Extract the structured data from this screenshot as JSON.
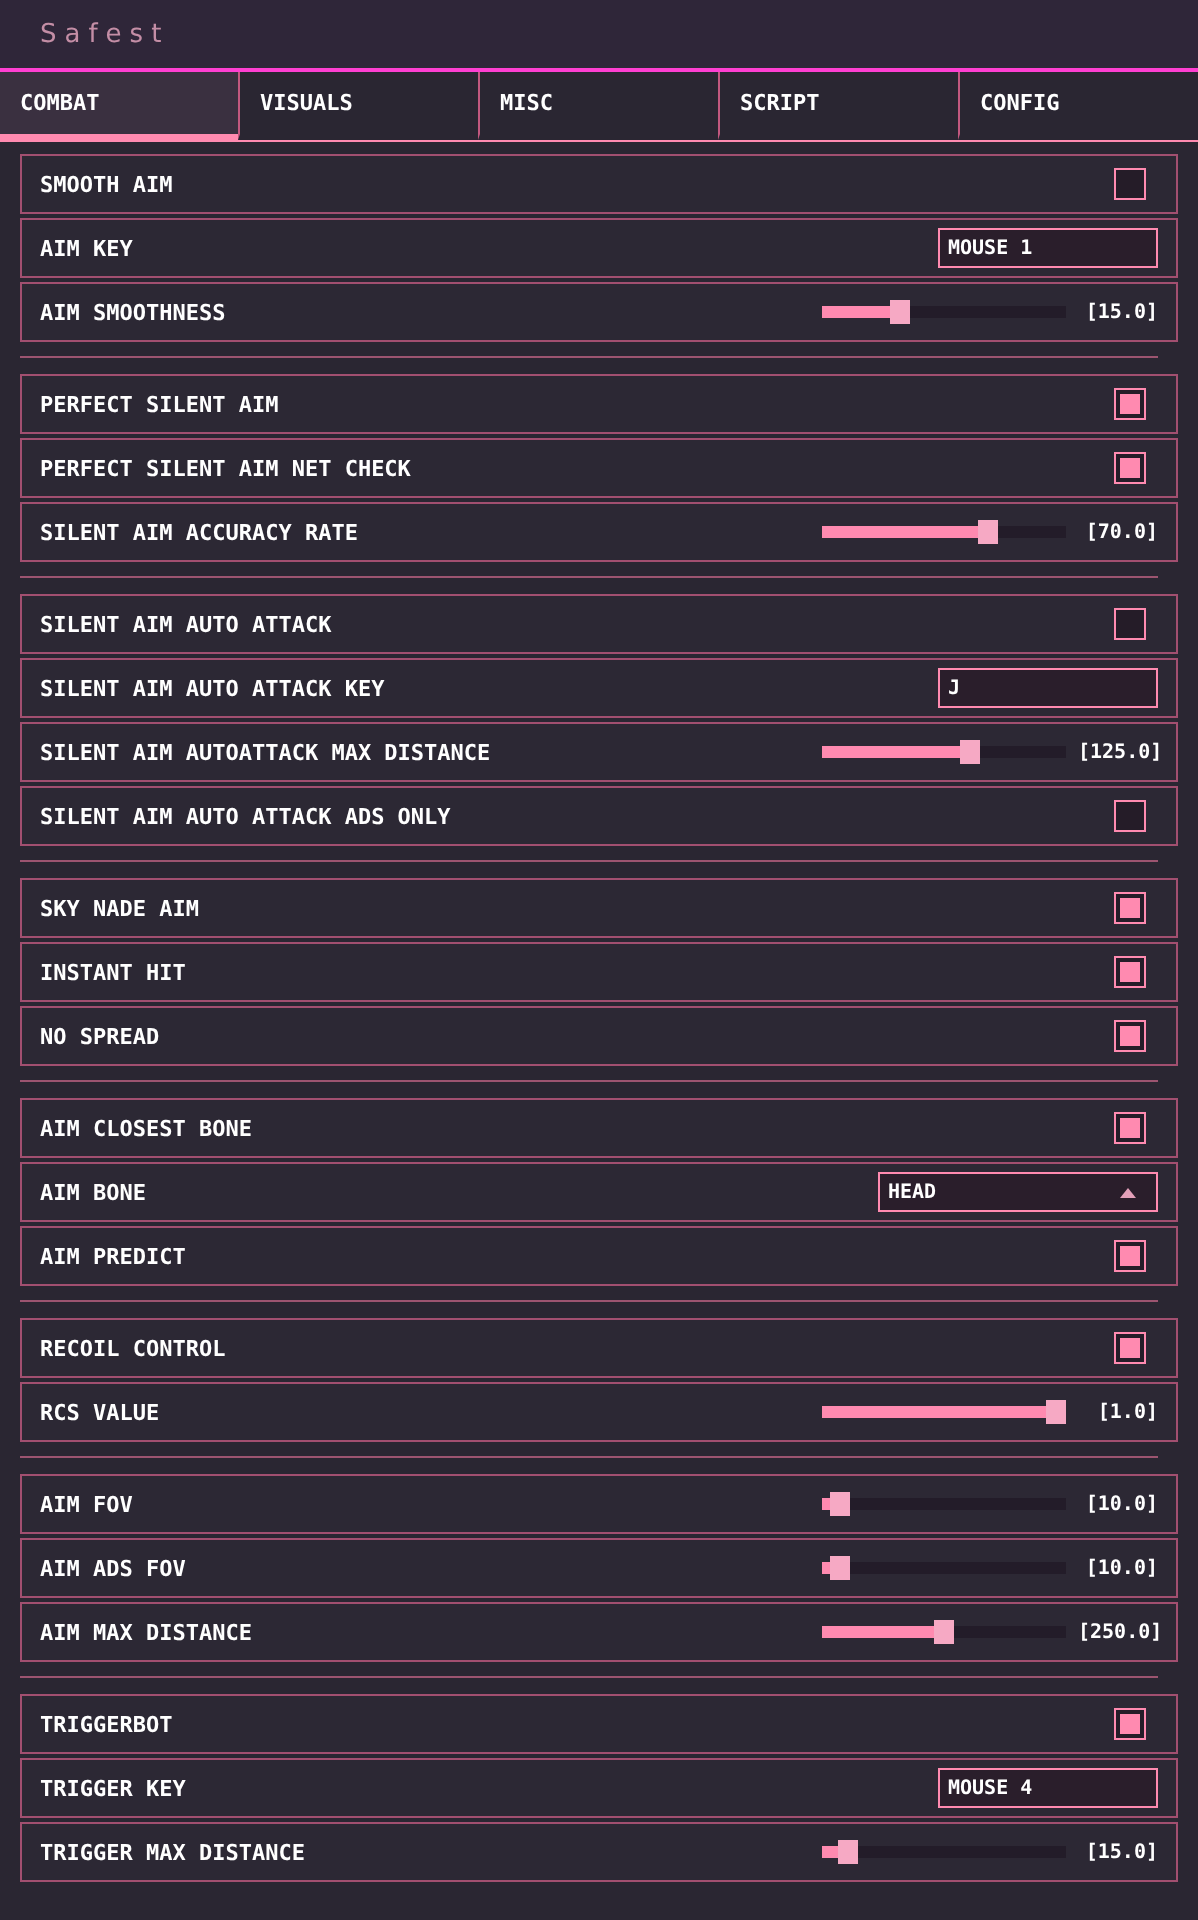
{
  "window": {
    "title": "Safest"
  },
  "tabs": [
    {
      "label": "COMBAT",
      "selected": true
    },
    {
      "label": "VISUALS",
      "selected": false
    },
    {
      "label": "MISC",
      "selected": false
    },
    {
      "label": "SCRIPT",
      "selected": false
    },
    {
      "label": "CONFIG",
      "selected": false
    }
  ],
  "groups": [
    {
      "rows": [
        {
          "kind": "checkbox",
          "label": "SMOOTH AIM",
          "checked": false
        },
        {
          "kind": "key",
          "label": "AIM KEY",
          "value": "MOUSE 1"
        },
        {
          "kind": "slider",
          "label": "AIM SMOOTHNESS",
          "level": 0.3,
          "reading": "[15.0]"
        }
      ]
    },
    {
      "rows": [
        {
          "kind": "checkbox",
          "label": "PERFECT SILENT AIM",
          "checked": true
        },
        {
          "kind": "checkbox",
          "label": "PERFECT SILENT AIM NET CHECK",
          "checked": true
        },
        {
          "kind": "slider",
          "label": "SILENT AIM ACCURACY RATE",
          "level": 0.7,
          "reading": "[70.0]"
        }
      ]
    },
    {
      "rows": [
        {
          "kind": "checkbox",
          "label": "SILENT AIM AUTO ATTACK",
          "checked": false
        },
        {
          "kind": "key",
          "label": "SILENT AIM AUTO ATTACK KEY",
          "value": "J"
        },
        {
          "kind": "slider",
          "label": "SILENT AIM AUTOATTACK MAX DISTANCE",
          "level": 0.62,
          "reading": "[125.0]"
        },
        {
          "kind": "checkbox",
          "label": "SILENT AIM AUTO ATTACK ADS ONLY",
          "checked": false
        }
      ]
    },
    {
      "rows": [
        {
          "kind": "checkbox",
          "label": "SKY NADE AIM",
          "checked": true
        },
        {
          "kind": "checkbox",
          "label": "INSTANT HIT",
          "checked": true
        },
        {
          "kind": "checkbox",
          "label": "NO SPREAD",
          "checked": true
        }
      ]
    },
    {
      "rows": [
        {
          "kind": "checkbox",
          "label": "AIM CLOSEST BONE",
          "checked": true
        },
        {
          "kind": "dropdown",
          "label": "AIM BONE",
          "value": "HEAD",
          "expanded": true
        },
        {
          "kind": "checkbox",
          "label": "AIM PREDICT",
          "checked": true
        }
      ]
    },
    {
      "rows": [
        {
          "kind": "checkbox",
          "label": "RECOIL CONTROL",
          "checked": true
        },
        {
          "kind": "slider",
          "label": "RCS VALUE",
          "level": 1,
          "reading": "[1.0]"
        }
      ]
    },
    {
      "rows": [
        {
          "kind": "slider",
          "label": "AIM FOV",
          "level": 0.04,
          "reading": "[10.0]"
        },
        {
          "kind": "slider",
          "label": "AIM ADS FOV",
          "level": 0.04,
          "reading": "[10.0]"
        },
        {
          "kind": "slider",
          "label": "AIM MAX DISTANCE",
          "level": 0.5,
          "reading": "[250.0]"
        }
      ]
    },
    {
      "rows": [
        {
          "kind": "checkbox",
          "label": "TRIGGERBOT",
          "checked": true
        },
        {
          "kind": "key",
          "label": "TRIGGER KEY",
          "value": "MOUSE 4"
        },
        {
          "kind": "slider",
          "label": "TRIGGER MAX DISTANCE",
          "level": 0.07,
          "reading": "[15.0]"
        }
      ]
    }
  ]
}
